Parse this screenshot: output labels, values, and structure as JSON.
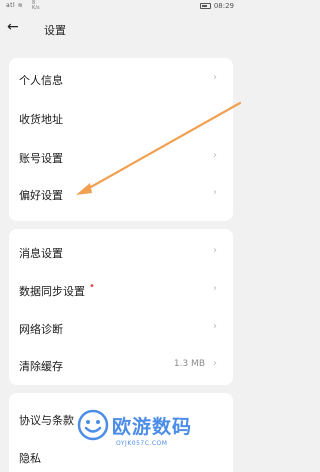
{
  "status_bar": {
    "signal": "atl ≋",
    "net_speed_top": "8",
    "net_speed_unit": "K/s",
    "battery": "",
    "time": "08:29"
  },
  "header": {
    "back_icon": "arrow-left-icon",
    "title": "设置"
  },
  "groups": [
    {
      "items": [
        {
          "label": "个人信息"
        },
        {
          "label": "收货地址"
        },
        {
          "label": "账号设置"
        },
        {
          "label": "偏好设置"
        }
      ]
    },
    {
      "items": [
        {
          "label": "消息设置"
        },
        {
          "label": "数据同步设置",
          "badge": "•"
        },
        {
          "label": "网络诊断"
        },
        {
          "label": "清除缓存",
          "value": "1.3 MB"
        }
      ]
    },
    {
      "items": [
        {
          "label": "协议与条款"
        },
        {
          "label": "隐私"
        }
      ]
    }
  ],
  "chevron": "›",
  "watermark": {
    "title": "欧游数码",
    "subtitle": "OYJK057C.COM"
  },
  "colors": {
    "annotation_arrow": "#f0a050",
    "badge": "#e94a4a",
    "watermark": "#4c8de8"
  }
}
